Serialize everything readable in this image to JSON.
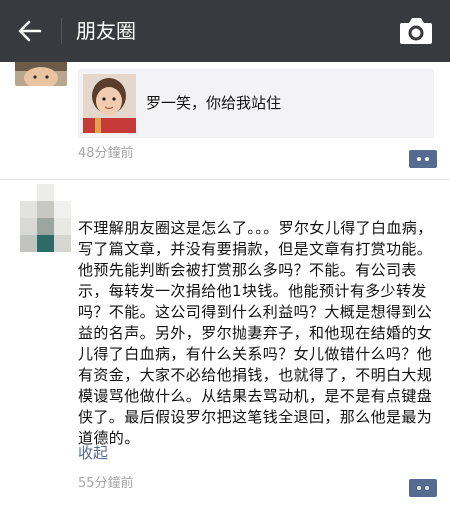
{
  "header": {
    "title": "朋友圈",
    "back_icon": "back-arrow-icon",
    "camera_icon": "camera-icon",
    "background": "#393a3f"
  },
  "post1": {
    "link_card": {
      "text": "罗一笑，你给我站住"
    },
    "time": "48分鐘前"
  },
  "post2": {
    "text": "不理解朋友圈这是怎么了。。。罗尔女儿得了白血病，写了篇文章，并没有要捐款，但是文章有打赏功能。他预先能判断会被打赏那么多吗？不能。有公司表示，每转发一次捐给他1块钱。他能预计有多少转发吗？不能。这公司得到什么利益吗？大概是想得到公益的名声。另外，罗尔抛妻弃子，和他现在结婚的女儿得了白血病，有什么关系吗？女儿做错什么吗？他有资金，大家不必给他捐钱，也就得了，不明白大规模谩骂他做什么。从结果去骂动机，是不是有点键盘侠了。最后假设罗尔把这笔钱全退回，那么他是最为道德的。",
    "collapse": "收起",
    "time": "55分鐘前"
  },
  "colors": {
    "link": "#576b95",
    "comment_button": "#556b92",
    "timestamp": "#a8a8a8"
  }
}
